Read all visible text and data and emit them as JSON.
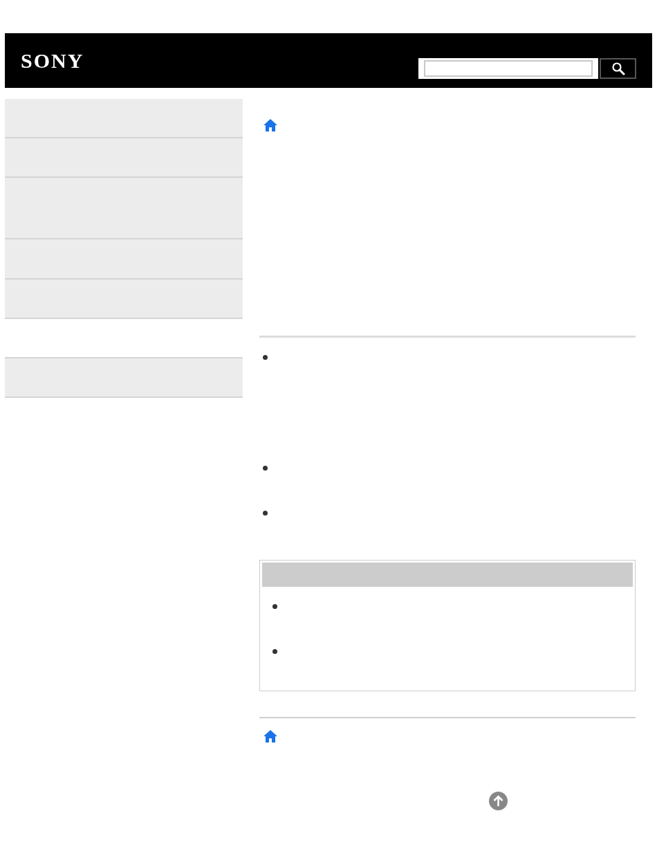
{
  "header": {
    "logo": "SONY"
  }
}
